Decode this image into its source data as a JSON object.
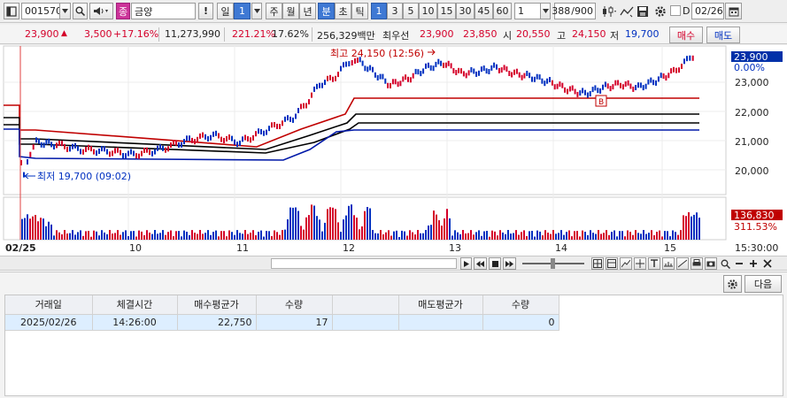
{
  "toolbar": {
    "stock_code": "001570",
    "stock_badge": "종",
    "stock_name": "금양",
    "alert_label": "!",
    "period_day": "일",
    "period_value": "1",
    "period_week": "주",
    "period_month": "월",
    "period_year": "년",
    "period_minute": "분",
    "period_second": "초",
    "period_tick": "틱",
    "intervals": [
      "1",
      "3",
      "5",
      "10",
      "15",
      "30",
      "45",
      "60"
    ],
    "interval_selected": "1",
    "spin_value": "1",
    "display_count": "388",
    "display_total": "/900",
    "checkbox_d_label": "D",
    "date_value": "02/26"
  },
  "quote": {
    "price": "23,900",
    "change_arrow": "▲",
    "change": "3,500",
    "change_pct": "+17.16%",
    "volume": "11,273,990",
    "volume_ratio": "221.21%",
    "turnover": "17.62%",
    "amount": "256,329백만",
    "best_ask_label": "최우선",
    "best_ask": "23,900",
    "best_bid": "23,850",
    "open_label": "시",
    "open": "20,550",
    "high_label": "고",
    "high": "24,150",
    "low_label": "저",
    "low": "19,700",
    "buy_label": "매수",
    "sell_label": "매도"
  },
  "chart": {
    "high_marker": "최고 24,150 (12:56)",
    "low_marker": "최저 19,700 (09:02)",
    "b_marker": "B",
    "price_badge": "23,900",
    "pct_badge": "0.00%",
    "y_labels": [
      "23,000",
      "22,000",
      "21,000",
      "20,000"
    ],
    "vol_badge": "136,830",
    "vol_pct": "311.53%",
    "x_labels": [
      "02/25",
      "10",
      "11",
      "12",
      "13",
      "14",
      "15",
      "15:30:00"
    ],
    "colors": {
      "up": "#d4002a",
      "down": "#0030c0",
      "line_red": "#c00000",
      "line_black": "#000000",
      "line_blue": "#0018a8"
    }
  },
  "panel": {
    "next_label": "다음",
    "headers": [
      "거래일",
      "체결시간",
      "매수평균가",
      "수량",
      "",
      "매도평균가",
      "수량"
    ],
    "rows": [
      [
        "2025/02/26",
        "14:26:00",
        "22,750",
        "17",
        "",
        "",
        "0"
      ]
    ]
  }
}
